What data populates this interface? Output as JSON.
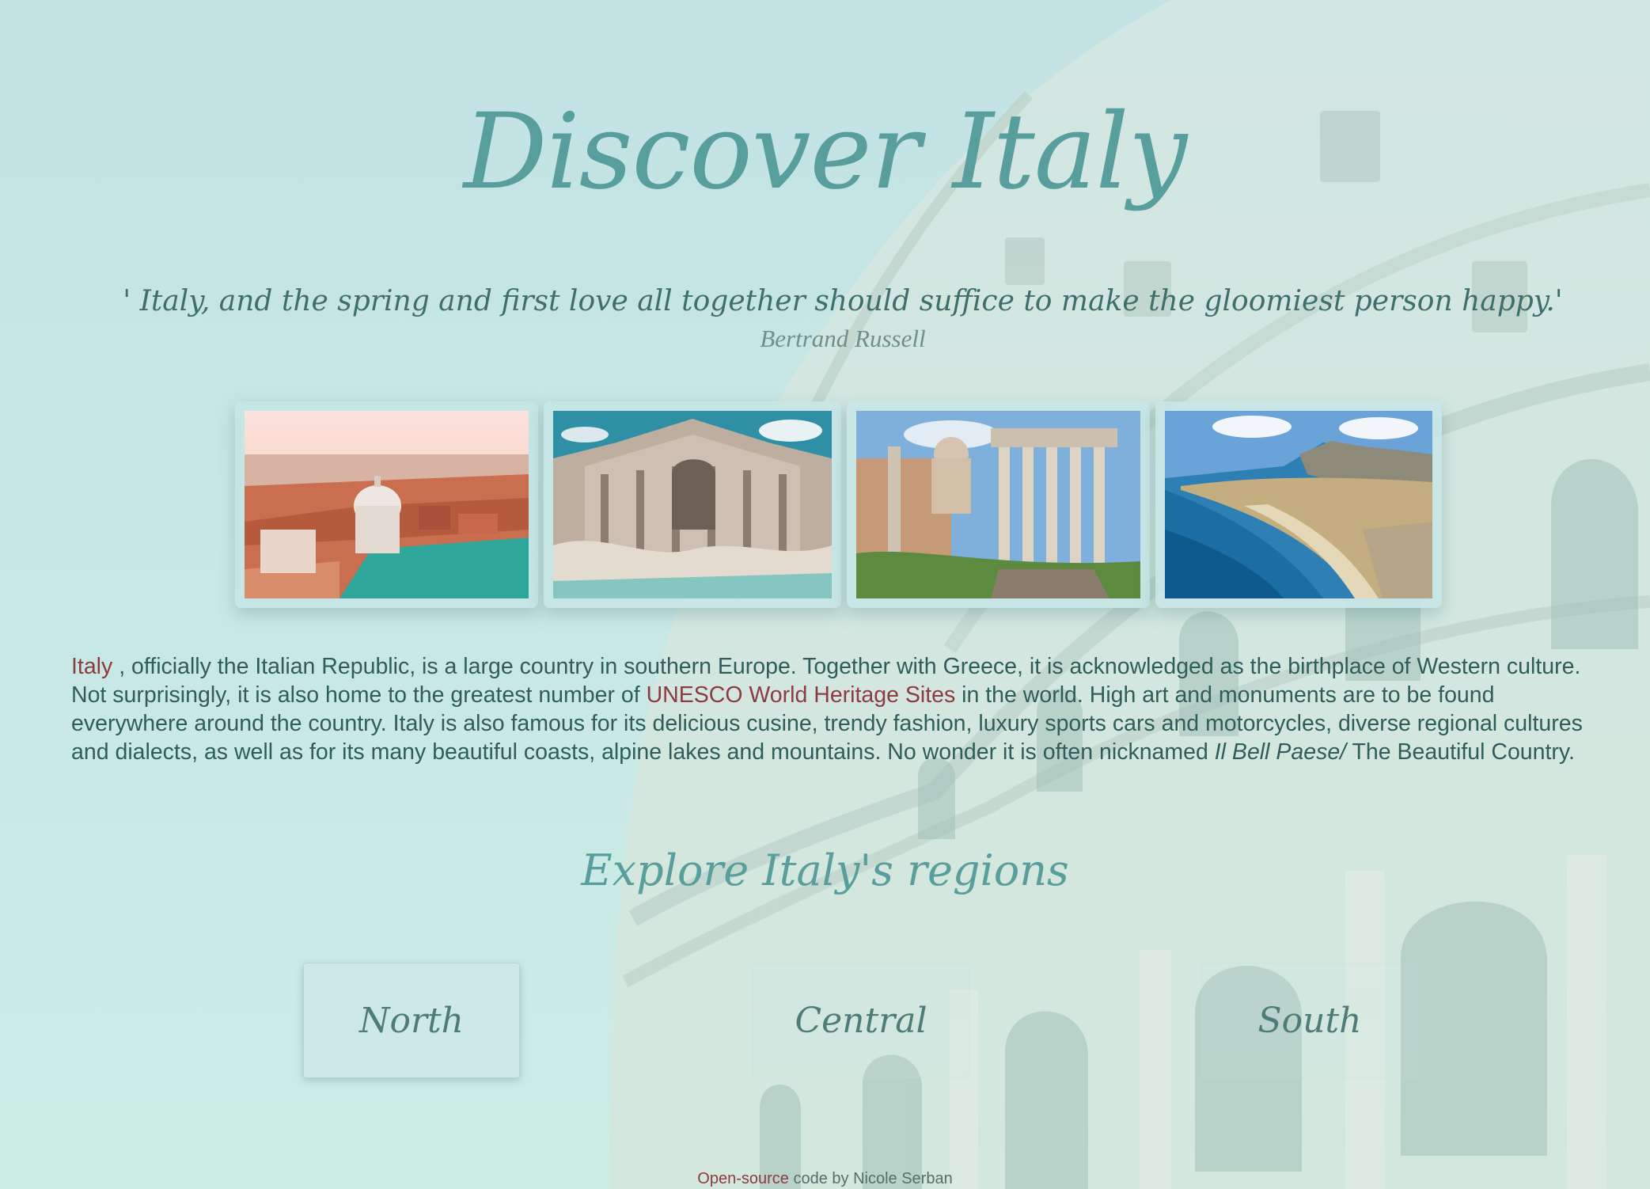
{
  "header": {
    "title": "Discover Italy"
  },
  "quote": {
    "text": "' Italy, and the spring and first love all together should suffice to make the gloomiest person happy.'",
    "author": "Bertrand Russell"
  },
  "gallery": {
    "photos": [
      {
        "subject": "venice-aerial"
      },
      {
        "subject": "trevi-fountain"
      },
      {
        "subject": "roman-forum"
      },
      {
        "subject": "sicily-coastline"
      }
    ]
  },
  "description": {
    "italy_link": "Italy",
    "part1": " , officially the Italian Republic, is a large country in southern Europe. Together with Greece, it is acknowledged as the birthplace of Western culture. Not surprisingly, it is also home to the greatest number of ",
    "unesco_link": "UNESCO World Heritage Sites",
    "part2": " in the world. High art and monuments are to be found everywhere around the country. Italy is also famous for its delicious cusine, trendy fashion, luxury sports cars and motorcycles, diverse regional cultures and dialects, as well as for its many beautiful coasts, alpine lakes and mountains. No wonder it is often nicknamed ",
    "nickname": "Il Bell Paese/",
    "part3": " The Beautiful Country."
  },
  "regions": {
    "title": "Explore Italy's regions",
    "north": "North",
    "central": "Central",
    "south": "South"
  },
  "footer": {
    "link": "Open-source",
    "text": " code by Nicole Serban"
  },
  "colors": {
    "accent": "#579e9c",
    "link": "#8c3c3f",
    "text": "#2f5d5a",
    "background": "#c3e2e4"
  }
}
